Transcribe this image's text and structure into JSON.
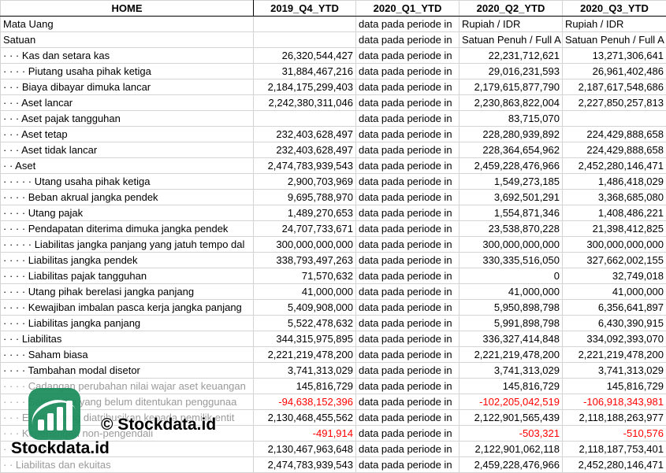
{
  "headers": [
    "HOME",
    "2019_Q4_YTD",
    "2020_Q1_YTD",
    "2020_Q2_YTD",
    "2020_Q3_YTD"
  ],
  "rows": [
    {
      "label": "Mata Uang",
      "cells": [
        "",
        "data pada periode in",
        "Rupiah / IDR",
        "Rupiah / IDR"
      ],
      "kind": "txt"
    },
    {
      "label": "Satuan",
      "cells": [
        "",
        "data pada periode in",
        "Satuan Penuh / Full A",
        "Satuan Penuh / Full A"
      ],
      "kind": "txt"
    },
    {
      "label": "· · · Kas dan setara kas",
      "cells": [
        "26,320,544,427",
        "data pada periode in",
        "22,231,712,621",
        "13,271,306,641"
      ]
    },
    {
      "label": "· · · · Piutang usaha pihak ketiga",
      "cells": [
        "31,884,467,216",
        "data pada periode in",
        "29,016,231,593",
        "26,961,402,486"
      ]
    },
    {
      "label": "· · · Biaya dibayar dimuka lancar",
      "cells": [
        "2,184,175,299,403",
        "data pada periode in",
        "2,179,615,877,790",
        "2,187,617,548,686"
      ]
    },
    {
      "label": "· · · Aset lancar",
      "cells": [
        "2,242,380,311,046",
        "data pada periode in",
        "2,230,863,822,004",
        "2,227,850,257,813"
      ]
    },
    {
      "label": "· · · Aset pajak tangguhan",
      "cells": [
        "",
        "data pada periode in",
        "83,715,070",
        ""
      ]
    },
    {
      "label": "· · · Aset tetap",
      "cells": [
        "232,403,628,497",
        "data pada periode in",
        "228,280,939,892",
        "224,429,888,658"
      ]
    },
    {
      "label": "· · · Aset tidak lancar",
      "cells": [
        "232,403,628,497",
        "data pada periode in",
        "228,364,654,962",
        "224,429,888,658"
      ]
    },
    {
      "label": "· · Aset",
      "cells": [
        "2,474,783,939,543",
        "data pada periode in",
        "2,459,228,476,966",
        "2,452,280,146,471"
      ]
    },
    {
      "label": "· · · · · Utang usaha pihak ketiga",
      "cells": [
        "2,900,703,969",
        "data pada periode in",
        "1,549,273,185",
        "1,486,418,029"
      ]
    },
    {
      "label": "· · · · Beban akrual jangka pendek",
      "cells": [
        "9,695,788,970",
        "data pada periode in",
        "3,692,501,291",
        "3,368,685,080"
      ]
    },
    {
      "label": "· · · · Utang pajak",
      "cells": [
        "1,489,270,653",
        "data pada periode in",
        "1,554,871,346",
        "1,408,486,221"
      ]
    },
    {
      "label": "· · · · Pendapatan diterima dimuka jangka pendek",
      "cells": [
        "24,707,733,671",
        "data pada periode in",
        "23,538,870,228",
        "21,398,412,825"
      ]
    },
    {
      "label": "· · · · · Liabilitas jangka panjang yang jatuh tempo dal",
      "cells": [
        "300,000,000,000",
        "data pada periode in",
        "300,000,000,000",
        "300,000,000,000"
      ]
    },
    {
      "label": "· · · · Liabilitas jangka pendek",
      "cells": [
        "338,793,497,263",
        "data pada periode in",
        "330,335,516,050",
        "327,662,002,155"
      ]
    },
    {
      "label": "· · · · Liabilitas pajak tangguhan",
      "cells": [
        "71,570,632",
        "data pada periode in",
        "0",
        "32,749,018"
      ]
    },
    {
      "label": "· · · · Utang pihak berelasi jangka panjang",
      "cells": [
        "41,000,000",
        "data pada periode in",
        "41,000,000",
        "41,000,000"
      ]
    },
    {
      "label": "· · · · Kewajiban imbalan pasca kerja jangka panjang",
      "cells": [
        "5,409,908,000",
        "data pada periode in",
        "5,950,898,798",
        "6,356,641,897"
      ]
    },
    {
      "label": "· · · · Liabilitas jangka panjang",
      "cells": [
        "5,522,478,632",
        "data pada periode in",
        "5,991,898,798",
        "6,430,390,915"
      ]
    },
    {
      "label": "· · · Liabilitas",
      "cells": [
        "344,315,975,895",
        "data pada periode in",
        "336,327,414,848",
        "334,092,393,070"
      ]
    },
    {
      "label": "· · · · Saham biasa",
      "cells": [
        "2,221,219,478,200",
        "data pada periode in",
        "2,221,219,478,200",
        "2,221,219,478,200"
      ]
    },
    {
      "label": "· · · · Tambahan modal disetor",
      "cells": [
        "3,741,313,029",
        "data pada periode in",
        "3,741,313,029",
        "3,741,313,029"
      ]
    },
    {
      "label": "· · · · Cadangan perubahan nilai wajar aset keuangan",
      "cells": [
        "145,816,729",
        "data pada periode in",
        "145,816,729",
        "145,816,729"
      ],
      "faded": true
    },
    {
      "label": "· · · · Saldo laba yang belum ditentukan penggunaa",
      "cells": [
        "-94,638,152,396",
        "data pada periode in",
        "-102,205,042,519",
        "-106,918,343,981"
      ],
      "faded": true
    },
    {
      "label": "· · · Ekuitas yang diatribusikan kepada pemilik entit",
      "cells": [
        "2,130,468,455,562",
        "data pada periode in",
        "2,122,901,565,439",
        "2,118,188,263,977"
      ],
      "faded": true
    },
    {
      "label": "· · · Kepentingan non-pengendali",
      "cells": [
        "-491,914",
        "data pada periode in",
        "-503,321",
        "-510,576"
      ],
      "faded": true
    },
    {
      "label": "· · · Ekuitas",
      "cells": [
        "2,130,467,963,648",
        "data pada periode in",
        "2,122,901,062,118",
        "2,118,187,753,401"
      ],
      "faded": true
    },
    {
      "label": "· · Liabilitas dan ekuitas",
      "cells": [
        "2,474,783,939,543",
        "data pada periode in",
        "2,459,228,476,966",
        "2,452,280,146,471"
      ],
      "faded": true
    }
  ],
  "watermark": {
    "copyright": "© Stockdata.id",
    "brand": "Stockdata.id",
    "logo_color": "#1a8c5a"
  },
  "colors": {
    "negative": "#ff0000",
    "grid": "#d4d4d4"
  }
}
